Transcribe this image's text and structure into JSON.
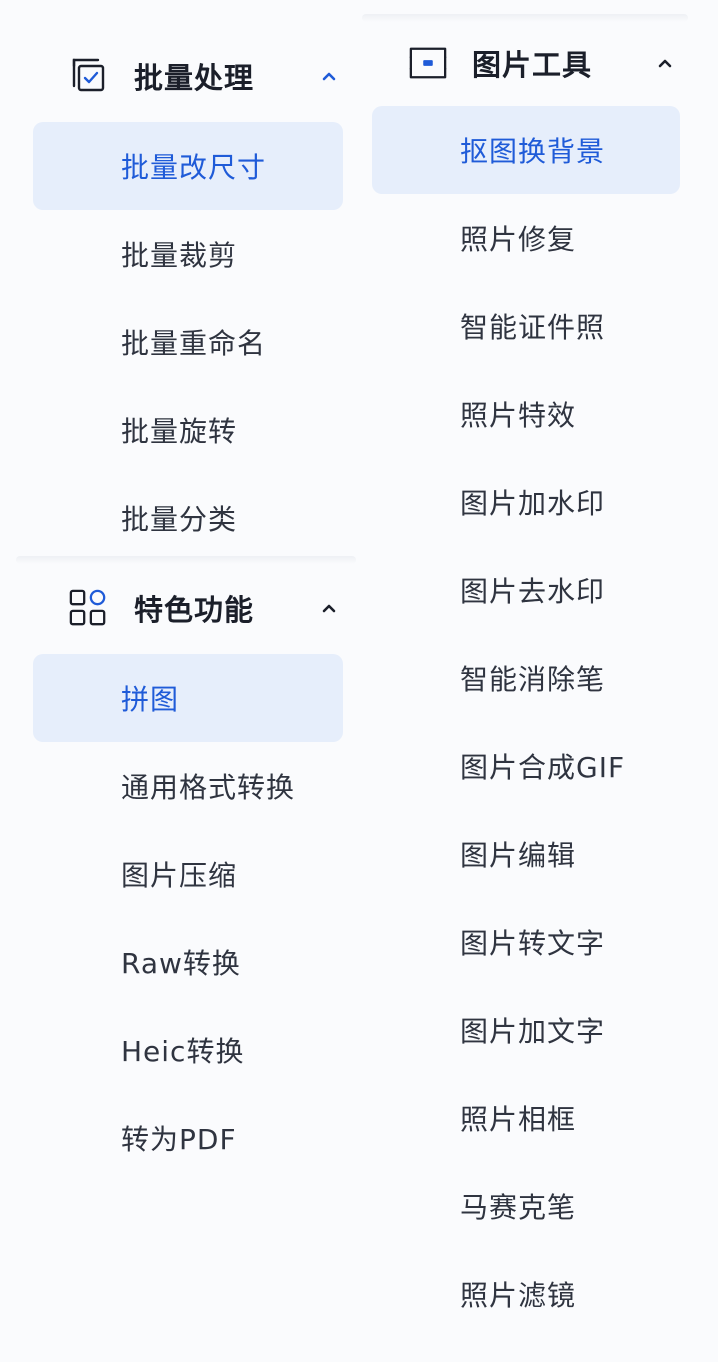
{
  "batch_section": {
    "title": "批量处理",
    "icon": "batch-copy-icon",
    "items": [
      {
        "label": "批量改尺寸",
        "selected": true
      },
      {
        "label": "批量裁剪",
        "selected": false
      },
      {
        "label": "批量重命名",
        "selected": false
      },
      {
        "label": "批量旋转",
        "selected": false
      },
      {
        "label": "批量分类",
        "selected": false
      }
    ]
  },
  "feature_section": {
    "title": "特色功能",
    "icon": "grid-icon",
    "items": [
      {
        "label": "拼图",
        "selected": true
      },
      {
        "label": "通用格式转换",
        "selected": false
      },
      {
        "label": "图片压缩",
        "selected": false
      },
      {
        "label": "Raw转换",
        "selected": false
      },
      {
        "label": "Heic转换",
        "selected": false
      },
      {
        "label": "转为PDF",
        "selected": false
      }
    ]
  },
  "image_tools_section": {
    "title": "图片工具",
    "icon": "image-frame-icon",
    "items": [
      {
        "label": "抠图换背景",
        "selected": true
      },
      {
        "label": "照片修复",
        "selected": false
      },
      {
        "label": "智能证件照",
        "selected": false
      },
      {
        "label": "照片特效",
        "selected": false
      },
      {
        "label": "图片加水印",
        "selected": false
      },
      {
        "label": "图片去水印",
        "selected": false
      },
      {
        "label": "智能消除笔",
        "selected": false
      },
      {
        "label": "图片合成GIF",
        "selected": false
      },
      {
        "label": "图片编辑",
        "selected": false
      },
      {
        "label": "图片转文字",
        "selected": false
      },
      {
        "label": "图片加文字",
        "selected": false
      },
      {
        "label": "照片相框",
        "selected": false
      },
      {
        "label": "马赛克笔",
        "selected": false
      },
      {
        "label": "照片滤镜",
        "selected": false
      }
    ]
  },
  "colors": {
    "accent": "#1f5bd8",
    "selected_bg": "#e6eefb",
    "text": "#2f3440",
    "title": "#1b1f2a"
  }
}
